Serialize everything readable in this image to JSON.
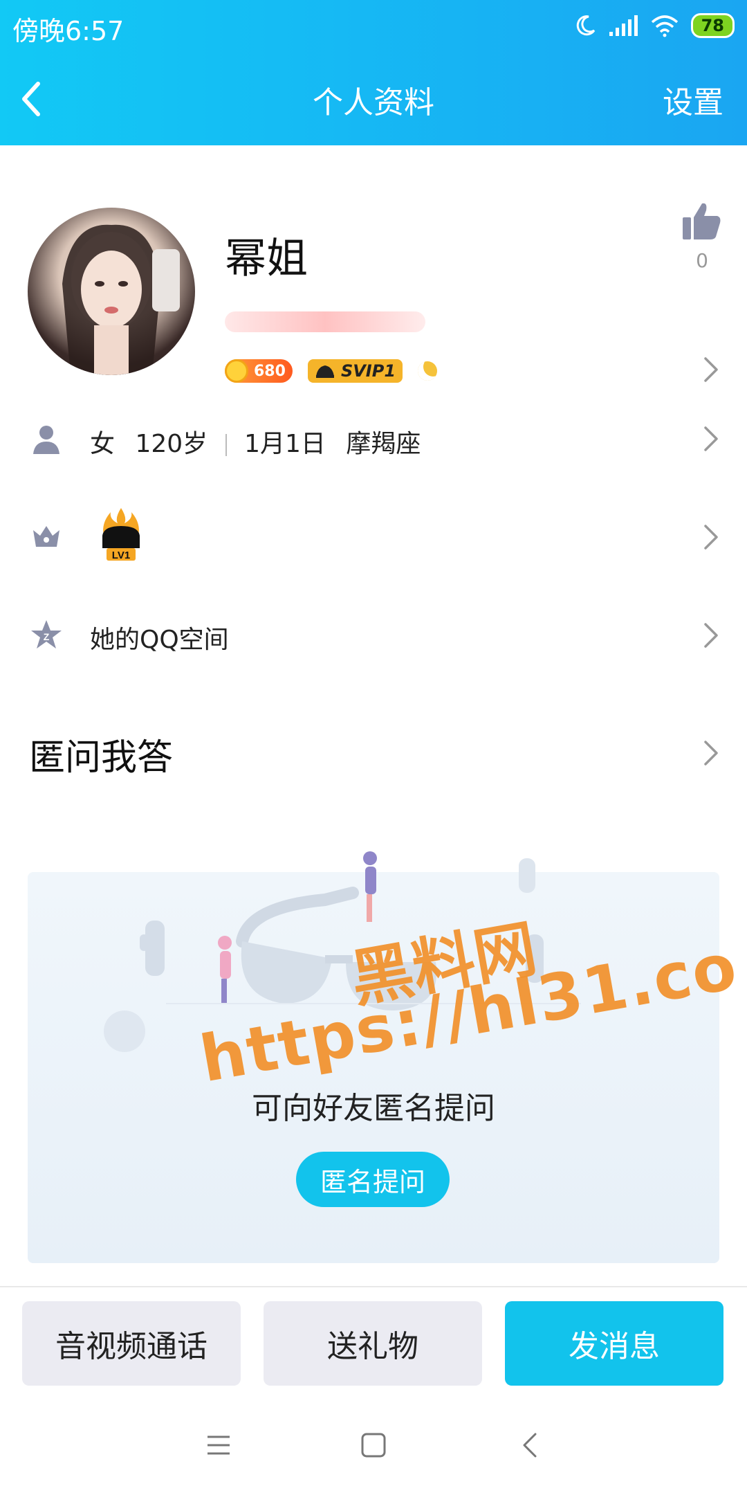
{
  "status_bar": {
    "time": "傍晚6:57",
    "battery": "78",
    "icons": [
      "moon-icon",
      "signal-icon",
      "wifi-icon",
      "battery-icon"
    ]
  },
  "header": {
    "title": "个人资料",
    "settings_label": "设置",
    "back_icon": "chevron-left-icon"
  },
  "profile": {
    "nickname": "幂姐",
    "like_count": "0",
    "coin_badge": "680",
    "vip_badge": "SVIP1"
  },
  "info_row": {
    "gender": "女",
    "age": "120岁",
    "birthday": "1月1日",
    "zodiac": "摩羯座"
  },
  "level_row": {
    "badge_text": "LV1"
  },
  "qzone_row": {
    "label": "她的QQ空间"
  },
  "anon_section": {
    "title": "匿问我答",
    "prompt": "可向好友匿名提问",
    "button_label": "匿名提问"
  },
  "watermark": {
    "line1": "黑料网",
    "line2": "https://hl31.co"
  },
  "actions": {
    "call_label": "音视频通话",
    "gift_label": "送礼物",
    "message_label": "发消息"
  },
  "colors": {
    "accent": "#12c3ec",
    "header_start": "#12c9f5",
    "header_end": "#1aa6f2",
    "watermark": "#f2912b"
  }
}
